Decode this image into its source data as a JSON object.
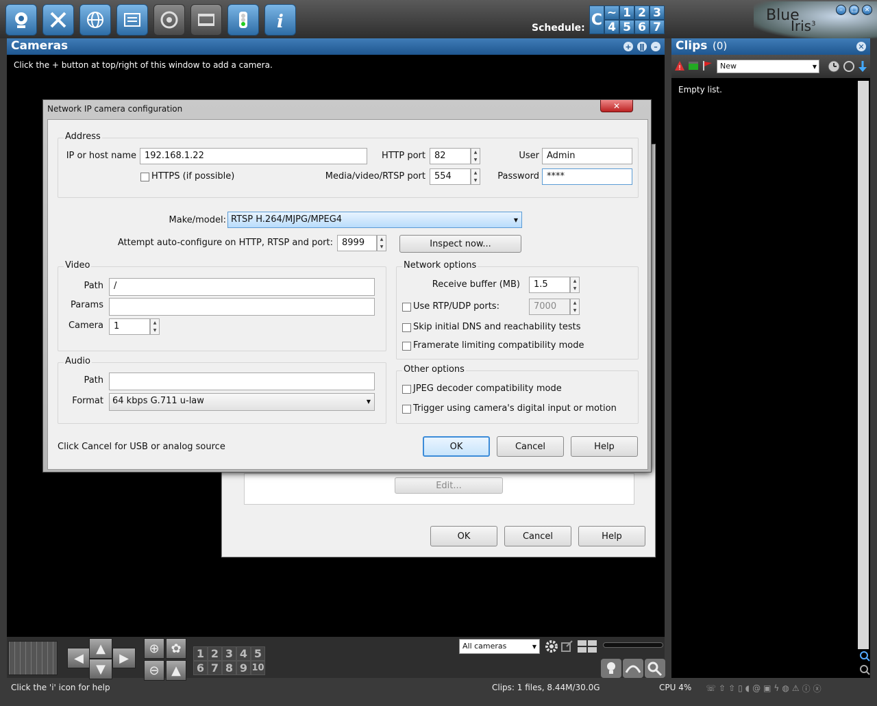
{
  "schedule": {
    "label": "Schedule:",
    "mode": "C",
    "top_row": [
      "~",
      "1",
      "2",
      "3"
    ],
    "bottom_row": [
      "4",
      "5",
      "6",
      "7"
    ]
  },
  "logo": {
    "line1": "Blue",
    "line2": "Iris",
    "version": "3"
  },
  "cameras": {
    "title": "Cameras",
    "hint": "Click the + button at top/right of this window to add a camera."
  },
  "clips": {
    "title": "Clips",
    "count": "(0)",
    "filter": "New",
    "empty": "Empty list."
  },
  "bottom": {
    "group_numbers": [
      "1",
      "2",
      "3",
      "4",
      "5",
      "6",
      "7",
      "8",
      "9",
      "10"
    ],
    "camera_filter": "All cameras"
  },
  "status": {
    "help": "Click the 'i' icon for help",
    "clips": "Clips: 1 files, 8.44M/30.0G",
    "cpu": "CPU 4%"
  },
  "background_dialog": {
    "edit": "Edit...",
    "ok": "OK",
    "cancel": "Cancel",
    "help": "Help"
  },
  "dialog": {
    "title": "Network IP camera configuration",
    "close": "✕",
    "address": {
      "title": "Address",
      "ip_label": "IP or host name",
      "ip_value": "192.168.1.22",
      "https_label": "HTTPS (if possible)",
      "http_port_label": "HTTP port",
      "http_port_value": "82",
      "media_port_label": "Media/video/RTSP port",
      "media_port_value": "554",
      "user_label": "User",
      "user_value": "Admin",
      "password_label": "Password",
      "password_value": "****"
    },
    "make_model_label": "Make/model:",
    "make_model_value": "RTSP H.264/MJPG/MPEG4",
    "autoconfig_label": "Attempt auto-configure on HTTP, RTSP and port:",
    "autoconfig_port": "8999",
    "inspect_button": "Inspect now...",
    "video": {
      "title": "Video",
      "path_label": "Path",
      "path_value": "/",
      "params_label": "Params",
      "params_value": "",
      "camera_label": "Camera",
      "camera_value": "1"
    },
    "audio": {
      "title": "Audio",
      "path_label": "Path",
      "path_value": "",
      "format_label": "Format",
      "format_value": "64 kbps G.711 u-law"
    },
    "network": {
      "title": "Network options",
      "buffer_label": "Receive buffer (MB)",
      "buffer_value": "1.5",
      "rtp_label": "Use RTP/UDP ports:",
      "rtp_value": "7000",
      "skip_dns_label": "Skip initial DNS and reachability tests",
      "framerate_label": "Framerate limiting compatibility mode"
    },
    "other": {
      "title": "Other options",
      "jpeg_label": "JPEG decoder compatibility mode",
      "trigger_label": "Trigger using camera's digital input or motion"
    },
    "footer_hint": "Click Cancel for USB or analog source",
    "ok": "OK",
    "cancel": "Cancel",
    "help": "Help"
  }
}
